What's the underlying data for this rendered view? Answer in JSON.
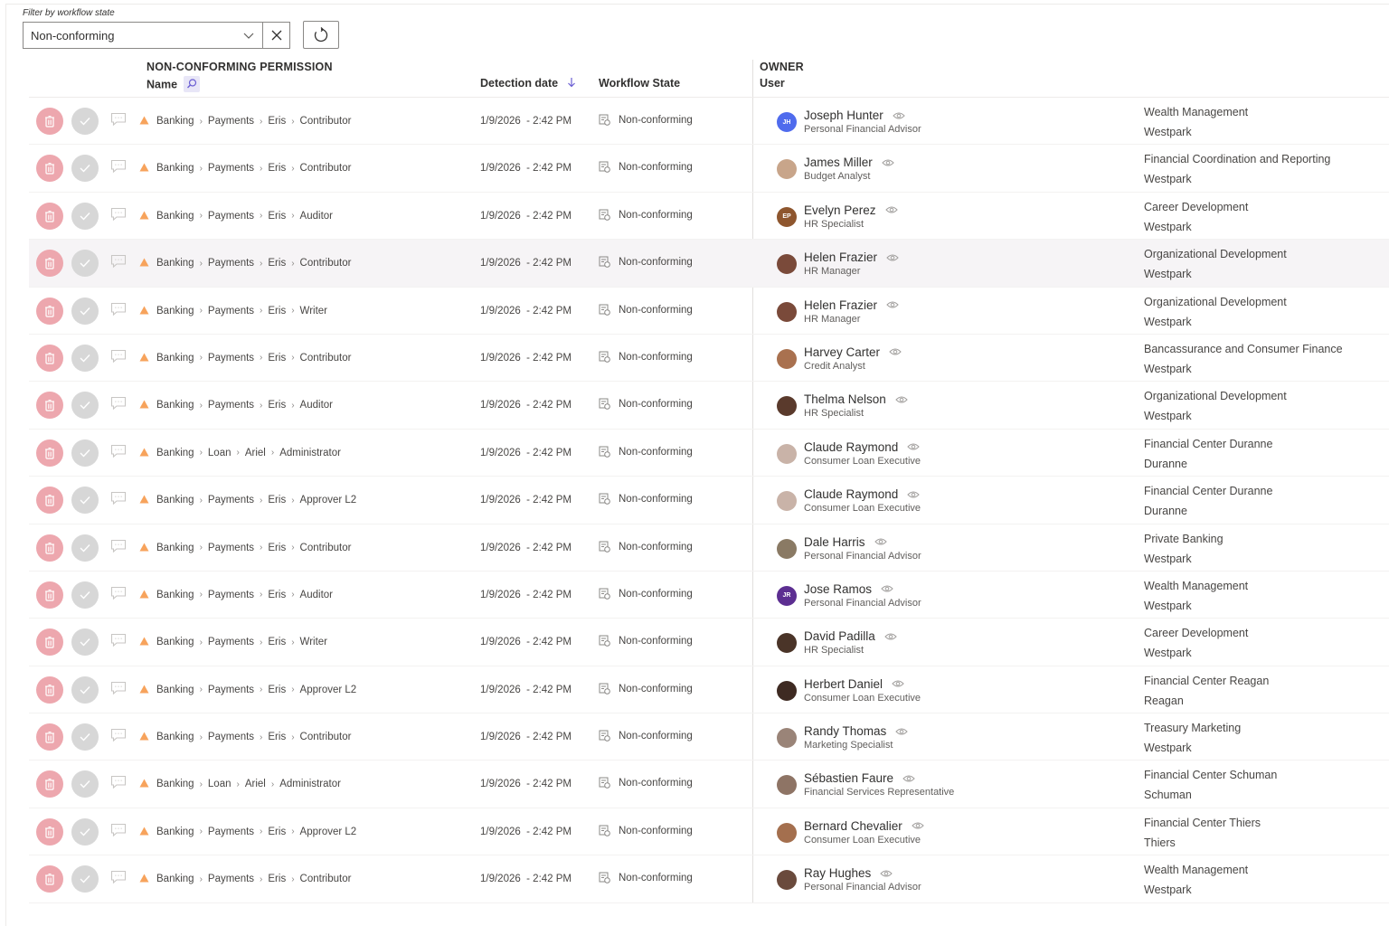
{
  "filter": {
    "label": "Filter by workflow state",
    "selected": "Non-conforming"
  },
  "header": {
    "group_permission": "NON-CONFORMING PERMISSION",
    "col_name": "Name",
    "col_detection": "Detection date",
    "col_workflow": "Workflow State",
    "group_owner": "OWNER",
    "col_user": "User"
  },
  "colors": {
    "delete": "#eda7ae",
    "approve": "#d7d7d7",
    "warning": "#f7a35c",
    "highlight_row": "#f6f4f6"
  },
  "rows": [
    {
      "p1": "Banking",
      "p2": "Payments",
      "p3": "Eris",
      "p4": "Contributor",
      "date": "1/9/2026",
      "time": "- 2:42 PM",
      "wf": "Non-conforming",
      "avatar": "JH",
      "avatar_bg": "#4f6bed",
      "name": "Joseph Hunter",
      "title": "Personal Financial Advisor",
      "dept": "Wealth Management",
      "loc": "Westpark"
    },
    {
      "p1": "Banking",
      "p2": "Payments",
      "p3": "Eris",
      "p4": "Contributor",
      "date": "1/9/2026",
      "time": "- 2:42 PM",
      "wf": "Non-conforming",
      "avatar": "",
      "avatar_bg": "#c8a58a",
      "name": "James Miller",
      "title": "Budget Analyst",
      "dept": "Financial Coordination and Reporting",
      "loc": "Westpark"
    },
    {
      "p1": "Banking",
      "p2": "Payments",
      "p3": "Eris",
      "p4": "Auditor",
      "date": "1/9/2026",
      "time": "- 2:42 PM",
      "wf": "Non-conforming",
      "avatar": "EP",
      "avatar_bg": "#8e562e",
      "name": "Evelyn Perez",
      "title": "HR Specialist",
      "dept": "Career Development",
      "loc": "Westpark"
    },
    {
      "p1": "Banking",
      "p2": "Payments",
      "p3": "Eris",
      "p4": "Contributor",
      "date": "1/9/2026",
      "time": "- 2:42 PM",
      "wf": "Non-conforming",
      "avatar": "",
      "avatar_bg": "#7a4a3a",
      "name": "Helen Frazier",
      "title": "HR Manager",
      "dept": "Organizational Development",
      "loc": "Westpark",
      "hl": true
    },
    {
      "p1": "Banking",
      "p2": "Payments",
      "p3": "Eris",
      "p4": "Writer",
      "date": "1/9/2026",
      "time": "- 2:42 PM",
      "wf": "Non-conforming",
      "avatar": "",
      "avatar_bg": "#7a4a3a",
      "name": "Helen Frazier",
      "title": "HR Manager",
      "dept": "Organizational Development",
      "loc": "Westpark"
    },
    {
      "p1": "Banking",
      "p2": "Payments",
      "p3": "Eris",
      "p4": "Contributor",
      "date": "1/9/2026",
      "time": "- 2:42 PM",
      "wf": "Non-conforming",
      "avatar": "",
      "avatar_bg": "#a9714f",
      "name": "Harvey Carter",
      "title": "Credit Analyst",
      "dept": "Bancassurance and Consumer Finance",
      "loc": "Westpark"
    },
    {
      "p1": "Banking",
      "p2": "Payments",
      "p3": "Eris",
      "p4": "Auditor",
      "date": "1/9/2026",
      "time": "- 2:42 PM",
      "wf": "Non-conforming",
      "avatar": "",
      "avatar_bg": "#5a3a2c",
      "name": "Thelma Nelson",
      "title": "HR Specialist",
      "dept": "Organizational Development",
      "loc": "Westpark"
    },
    {
      "p1": "Banking",
      "p2": "Loan",
      "p3": "Ariel",
      "p4": "Administrator",
      "date": "1/9/2026",
      "time": "- 2:42 PM",
      "wf": "Non-conforming",
      "avatar": "",
      "avatar_bg": "#c9b3a8",
      "name": "Claude Raymond",
      "title": "Consumer Loan Executive",
      "dept": "Financial Center Duranne",
      "loc": "Duranne"
    },
    {
      "p1": "Banking",
      "p2": "Payments",
      "p3": "Eris",
      "p4": "Approver L2",
      "date": "1/9/2026",
      "time": "- 2:42 PM",
      "wf": "Non-conforming",
      "avatar": "",
      "avatar_bg": "#c9b3a8",
      "name": "Claude Raymond",
      "title": "Consumer Loan Executive",
      "dept": "Financial Center Duranne",
      "loc": "Duranne"
    },
    {
      "p1": "Banking",
      "p2": "Payments",
      "p3": "Eris",
      "p4": "Contributor",
      "date": "1/9/2026",
      "time": "- 2:42 PM",
      "wf": "Non-conforming",
      "avatar": "",
      "avatar_bg": "#8a7a64",
      "name": "Dale Harris",
      "title": "Personal Financial Advisor",
      "dept": "Private Banking",
      "loc": "Westpark"
    },
    {
      "p1": "Banking",
      "p2": "Payments",
      "p3": "Eris",
      "p4": "Auditor",
      "date": "1/9/2026",
      "time": "- 2:42 PM",
      "wf": "Non-conforming",
      "avatar": "JR",
      "avatar_bg": "#5c2e91",
      "name": "Jose Ramos",
      "title": "Personal Financial Advisor",
      "dept": "Wealth Management",
      "loc": "Westpark"
    },
    {
      "p1": "Banking",
      "p2": "Payments",
      "p3": "Eris",
      "p4": "Writer",
      "date": "1/9/2026",
      "time": "- 2:42 PM",
      "wf": "Non-conforming",
      "avatar": "",
      "avatar_bg": "#4a3428",
      "name": "David Padilla",
      "title": "HR Specialist",
      "dept": "Career Development",
      "loc": "Westpark"
    },
    {
      "p1": "Banking",
      "p2": "Payments",
      "p3": "Eris",
      "p4": "Approver L2",
      "date": "1/9/2026",
      "time": "- 2:42 PM",
      "wf": "Non-conforming",
      "avatar": "",
      "avatar_bg": "#3e2a22",
      "name": "Herbert Daniel",
      "title": "Consumer Loan Executive",
      "dept": "Financial Center Reagan",
      "loc": "Reagan"
    },
    {
      "p1": "Banking",
      "p2": "Payments",
      "p3": "Eris",
      "p4": "Contributor",
      "date": "1/9/2026",
      "time": "- 2:42 PM",
      "wf": "Non-conforming",
      "avatar": "",
      "avatar_bg": "#9a8478",
      "name": "Randy Thomas",
      "title": "Marketing Specialist",
      "dept": "Treasury Marketing",
      "loc": "Westpark"
    },
    {
      "p1": "Banking",
      "p2": "Loan",
      "p3": "Ariel",
      "p4": "Administrator",
      "date": "1/9/2026",
      "time": "- 2:42 PM",
      "wf": "Non-conforming",
      "avatar": "",
      "avatar_bg": "#8e7465",
      "name": "Sébastien Faure",
      "title": "Financial Services Representative",
      "dept": "Financial Center Schuman",
      "loc": "Schuman"
    },
    {
      "p1": "Banking",
      "p2": "Payments",
      "p3": "Eris",
      "p4": "Approver L2",
      "date": "1/9/2026",
      "time": "- 2:42 PM",
      "wf": "Non-conforming",
      "avatar": "",
      "avatar_bg": "#a46f4e",
      "name": "Bernard Chevalier",
      "title": "Consumer Loan Executive",
      "dept": "Financial Center Thiers",
      "loc": "Thiers"
    },
    {
      "p1": "Banking",
      "p2": "Payments",
      "p3": "Eris",
      "p4": "Contributor",
      "date": "1/9/2026",
      "time": "- 2:42 PM",
      "wf": "Non-conforming",
      "avatar": "",
      "avatar_bg": "#6a4a3c",
      "name": "Ray Hughes",
      "title": "Personal Financial Advisor",
      "dept": "Wealth Management",
      "loc": "Westpark"
    }
  ]
}
